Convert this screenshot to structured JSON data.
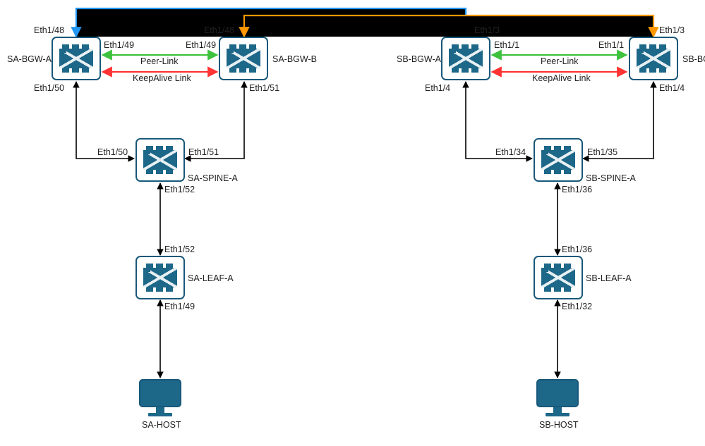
{
  "nodes": {
    "sa_bgw_a": "SA-BGW-A",
    "sa_bgw_b": "SA-BGW-B",
    "sb_bgw_a": "SB-BGW-A",
    "sb_bgw_b": "SB-BGW-B",
    "sa_spine_a": "SA-SPINE-A",
    "sb_spine_a": "SB-SPINE-A",
    "sa_leaf_a": "SA-LEAF-A",
    "sb_leaf_a": "SB-LEAF-A",
    "sa_host": "SA-HOST",
    "sb_host": "SB-HOST"
  },
  "links": {
    "peer_link": "Peer-Link",
    "keepalive": "KeepAlive Link"
  },
  "ports": {
    "sa_bgw_a_top": "Eth1/48",
    "sa_bgw_a_right": "Eth1/49",
    "sa_bgw_a_bot": "Eth1/50",
    "sa_bgw_b_top": "Eth1/48",
    "sa_bgw_b_left": "Eth1/49",
    "sa_bgw_b_bot": "Eth1/51",
    "sa_spine_left": "Eth1/50",
    "sa_spine_right": "Eth1/51",
    "sa_spine_bot": "Eth1/52",
    "sa_leaf_top": "Eth1/52",
    "sa_leaf_bot": "Eth1/49",
    "sb_bgw_a_top": "Eth1/3",
    "sb_bgw_a_right": "Eth1/1",
    "sb_bgw_a_bot": "Eth1/4",
    "sb_bgw_b_top": "Eth1/3",
    "sb_bgw_b_left": "Eth1/1",
    "sb_bgw_b_bot": "Eth1/4",
    "sb_spine_left": "Eth1/34",
    "sb_spine_right": "Eth1/35",
    "sb_spine_bot": "Eth1/36",
    "sb_leaf_top": "Eth1/36",
    "sb_leaf_bot": "Eth1/32"
  },
  "colors": {
    "blue": "#2196f3",
    "orange": "#ff9800",
    "green": "#3ec23e",
    "red": "#ff3333",
    "black": "#000000",
    "node_border": "#18587a",
    "node_fill": "#1d6789"
  }
}
